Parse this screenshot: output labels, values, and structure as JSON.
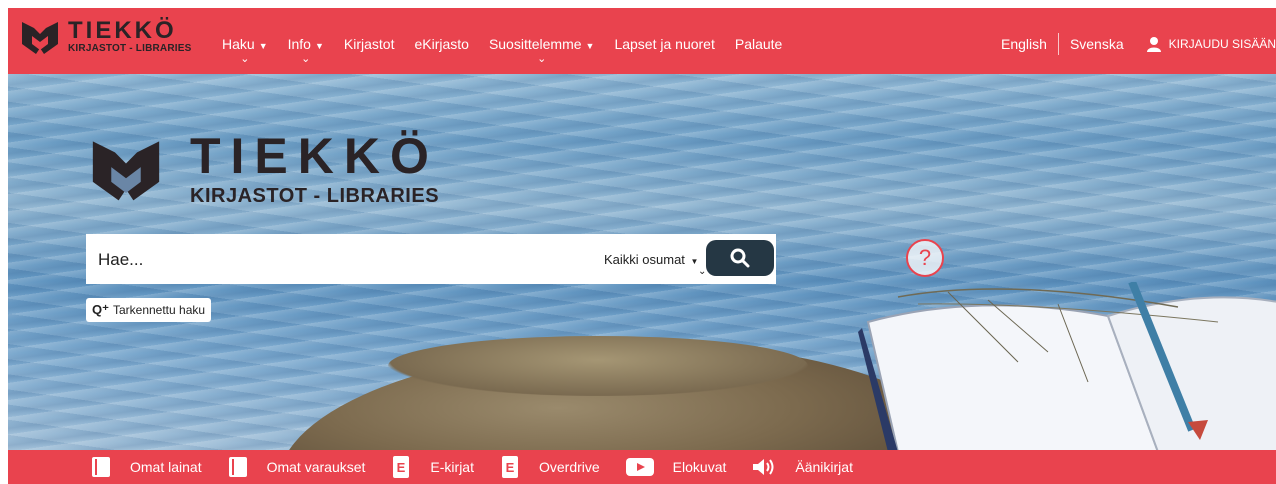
{
  "header": {
    "logo_title": "TIEKKÖ",
    "logo_subtitle": "KIRJASTOT - LIBRARIES",
    "nav": [
      {
        "label": "Haku",
        "dropdown": true
      },
      {
        "label": "Info",
        "dropdown": true
      },
      {
        "label": "Kirjastot",
        "dropdown": false
      },
      {
        "label": "eKirjasto",
        "dropdown": false
      },
      {
        "label": "Suosittelemme",
        "dropdown": true
      },
      {
        "label": "Lapset ja nuoret",
        "dropdown": false
      },
      {
        "label": "Palaute",
        "dropdown": false
      }
    ],
    "lang_english": "English",
    "lang_swedish": "Svenska",
    "login_label": "KIRJAUDU SISÄÄN"
  },
  "hero": {
    "logo_title": "TIEKKÖ",
    "logo_subtitle": "KIRJASTOT - LIBRARIES"
  },
  "search": {
    "placeholder": "Hae...",
    "scope": "Kaikki osumat",
    "advanced": "Tarkennettu haku",
    "help": "?"
  },
  "footer_links": [
    {
      "label": "Omat lainat",
      "icon": "book-icon"
    },
    {
      "label": "Omat varaukset",
      "icon": "book-icon"
    },
    {
      "label": "E-kirjat",
      "icon": "ebook-icon"
    },
    {
      "label": "Overdrive",
      "icon": "ebook-icon"
    },
    {
      "label": "Elokuvat",
      "icon": "play-icon"
    },
    {
      "label": "Äänikirjat",
      "icon": "speaker-icon"
    }
  ],
  "colors": {
    "brand_red": "#e9434e",
    "dark": "#2a2326",
    "search_button": "#253744"
  }
}
